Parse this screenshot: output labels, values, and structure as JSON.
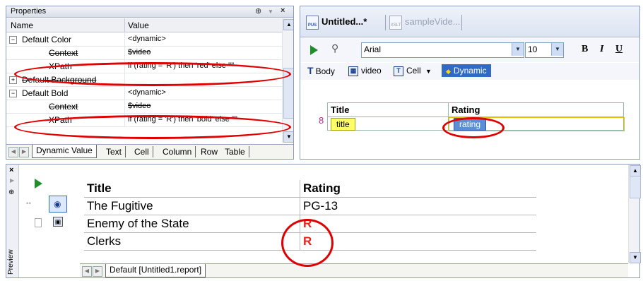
{
  "properties": {
    "title": "Properties",
    "pin_glyph": "⊕",
    "dropdown_glyph": "▼",
    "close_glyph": "×",
    "columns": {
      "name": "Name",
      "value": "Value"
    },
    "rows": [
      {
        "expander": "−",
        "name": "Default Color",
        "value": "<dynamic>",
        "level": 0
      },
      {
        "expander": "",
        "name": "Context",
        "value": "$video",
        "level": 1,
        "struck": true
      },
      {
        "expander": "",
        "name": "XPath",
        "value": "if (rating = 'R') then 'red' else ''\"",
        "level": 1
      },
      {
        "expander": "+",
        "name": "Default Background",
        "value": "",
        "level": 0,
        "struck": true
      },
      {
        "expander": "−",
        "name": "Default Bold",
        "value": "<dynamic>",
        "level": 0
      },
      {
        "expander": "",
        "name": "Context",
        "value": "$video",
        "level": 1,
        "struck": true
      },
      {
        "expander": "",
        "name": "XPath",
        "value": "if (rating = 'R') then 'bold' else '\"'",
        "level": 1
      }
    ],
    "tabs": [
      "Dynamic Value",
      "Text",
      "Cell",
      "Column",
      "Row",
      "Table"
    ],
    "active_tab": "Dynamic Value"
  },
  "designer": {
    "doc_tabs": [
      {
        "label": "Untitled...*",
        "icon": "PUS",
        "active": true
      },
      {
        "label": "sampleVide...",
        "icon": "XSLT",
        "active": false
      }
    ],
    "toolbar": {
      "font": "Arial",
      "size": "10",
      "bold": "B",
      "italic": "I",
      "underline": "U"
    },
    "breadcrumbs": [
      {
        "label": "Body",
        "icon": "T"
      },
      {
        "label": "video",
        "icon": "▦"
      },
      {
        "label": "Cell",
        "icon": "T",
        "dropdown": "▼"
      },
      {
        "label": "Dynamic",
        "icon": "◆"
      }
    ],
    "table": {
      "headers": [
        "Title",
        "Rating"
      ],
      "tags": [
        "title",
        "rating"
      ]
    }
  },
  "preview": {
    "side_label": "Preview",
    "close_glyph": "×",
    "table": {
      "headers": [
        "Title",
        "Rating"
      ],
      "rows": [
        {
          "title": "The Fugitive",
          "rating": "PG-13",
          "highlight": false
        },
        {
          "title": "Enemy of the State",
          "rating": "R",
          "highlight": true
        },
        {
          "title": "Clerks",
          "rating": "R",
          "highlight": true
        }
      ]
    },
    "tab": "Default [Untitled1.report]"
  },
  "colors": {
    "accent": "#316ac5",
    "annotation_red": "#e00000",
    "rating_red": "#e8231a",
    "tag_yellow": "#ffff66",
    "tag_blue": "#5a8fd6"
  }
}
